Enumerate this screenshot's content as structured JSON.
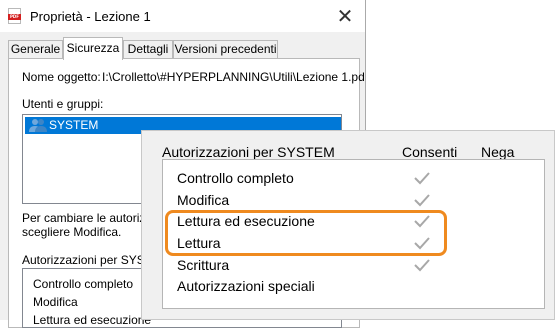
{
  "window": {
    "title": "Proprietà - Lezione 1",
    "app_icon_text": "PDF"
  },
  "tabs": [
    {
      "label": "Generale"
    },
    {
      "label": "Sicurezza"
    },
    {
      "label": "Dettagli"
    },
    {
      "label": "Versioni precedenti"
    }
  ],
  "active_tab": "Sicurezza",
  "object": {
    "label": "Nome oggetto:",
    "value": "I:\\Crolletto\\#HYPERPLANNING\\Utili\\Lezione 1.pd"
  },
  "users": {
    "label": "Utenti e gruppi:",
    "items": [
      "SYSTEM"
    ]
  },
  "change_hint": {
    "line1": "Per cambiare le autorizz",
    "line2": "scegliere Modifica."
  },
  "permissions_small": {
    "label": "Autorizzazioni per SYST",
    "rows": [
      "Controllo completo",
      "Modifica",
      "Lettura ed esecuzione"
    ]
  },
  "zoom": {
    "header": "Autorizzazioni per SYSTEM",
    "allow_header": "Consenti",
    "deny_header": "Nega",
    "rows": [
      {
        "label": "Controllo completo",
        "allow": true
      },
      {
        "label": "Modifica",
        "allow": true
      },
      {
        "label": "Lettura ed esecuzione",
        "allow": true
      },
      {
        "label": "Lettura",
        "allow": true
      },
      {
        "label": "Scrittura",
        "allow": true
      },
      {
        "label": "Autorizzazioni speciali",
        "allow": false
      }
    ],
    "highlight_color": "#ef8a1f",
    "check_color": "#a8a8a8"
  },
  "colors": {
    "selection": "#0078d7"
  }
}
